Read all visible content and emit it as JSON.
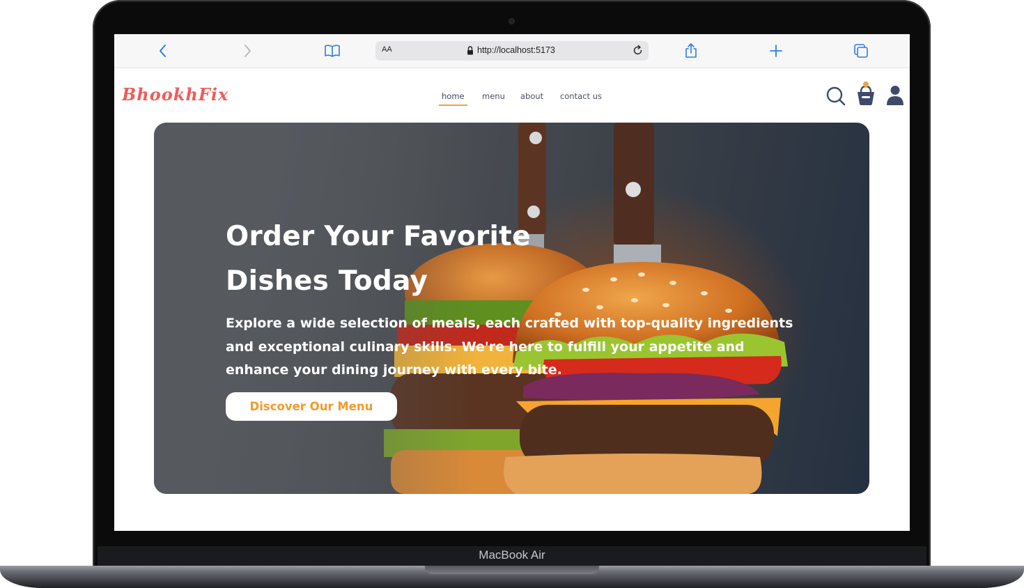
{
  "browser": {
    "aa_label": "AA",
    "url": "http://localhost:5173",
    "icons": [
      "chevron-left-icon",
      "chevron-right-icon",
      "book-icon",
      "lock-icon",
      "reload-icon",
      "share-icon",
      "plus-icon",
      "tabs-icon"
    ]
  },
  "site": {
    "logo": "BhookhFix",
    "nav": [
      {
        "label": "home",
        "active": true
      },
      {
        "label": "menu",
        "active": false
      },
      {
        "label": "about",
        "active": false
      },
      {
        "label": "contact us",
        "active": false
      }
    ],
    "header_icons": [
      "search-icon",
      "basket-icon",
      "user-icon"
    ]
  },
  "hero": {
    "title": "Order Your Favorite Dishes Today",
    "description": "Explore a wide selection of meals, each crafted with top-quality ingredients and exceptional culinary skills. We're here to fulfill your appetite and enhance your dining journey with every bite.",
    "button_label": "Discover Our Menu"
  },
  "device": {
    "model": "MacBook Air"
  },
  "colors": {
    "logo": "#ef5c5c",
    "accent": "#f3a33c",
    "icon": "#3f4a6b",
    "browser_blue": "#2f7ae5"
  }
}
